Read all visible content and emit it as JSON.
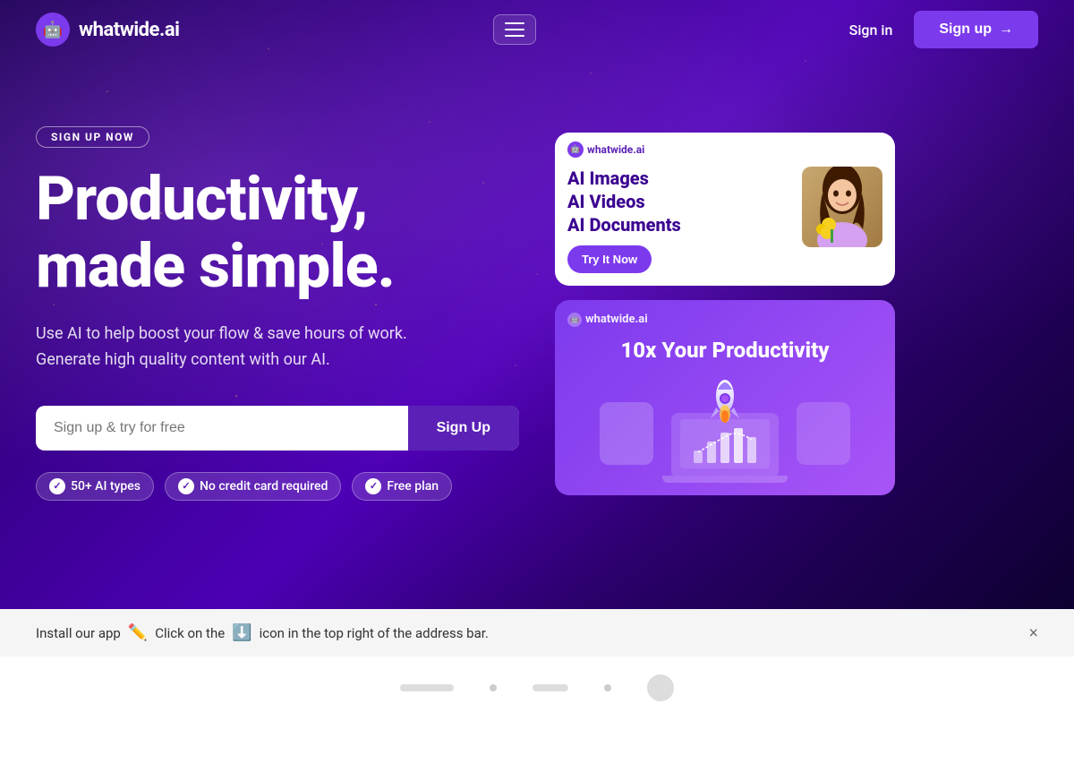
{
  "brand": {
    "name": "whatwide.ai",
    "logo_emoji": "🤖"
  },
  "navbar": {
    "signin_label": "Sign in",
    "signup_label": "Sign up",
    "signup_arrow": "→"
  },
  "hero": {
    "badge_label": "SIGN UP NOW",
    "title_line1": "Productivity,",
    "title_line2": "made simple.",
    "subtitle_line1": "Use AI to help boost your flow & save hours of work.",
    "subtitle_line2": "Generate high quality content with our AI.",
    "input_placeholder": "Sign up & try for free",
    "signup_btn_label": "Sign Up",
    "badges": [
      {
        "label": "50+ AI types"
      },
      {
        "label": "No credit card required"
      },
      {
        "label": "Free plan"
      }
    ]
  },
  "card1": {
    "logo_text": "whatwide.ai",
    "line1": "AI Images",
    "line2": "AI Videos",
    "line3": "AI Documents",
    "try_btn_label": "Try It Now"
  },
  "card2": {
    "logo_text": "whatwide.ai",
    "title": "10x Your Productivity"
  },
  "install_banner": {
    "text_before": "Install our app",
    "icon": "✏️",
    "text_after": "Click on the",
    "icon2": "⬇️",
    "text_end": "icon in the top right of the address bar.",
    "close": "×"
  }
}
